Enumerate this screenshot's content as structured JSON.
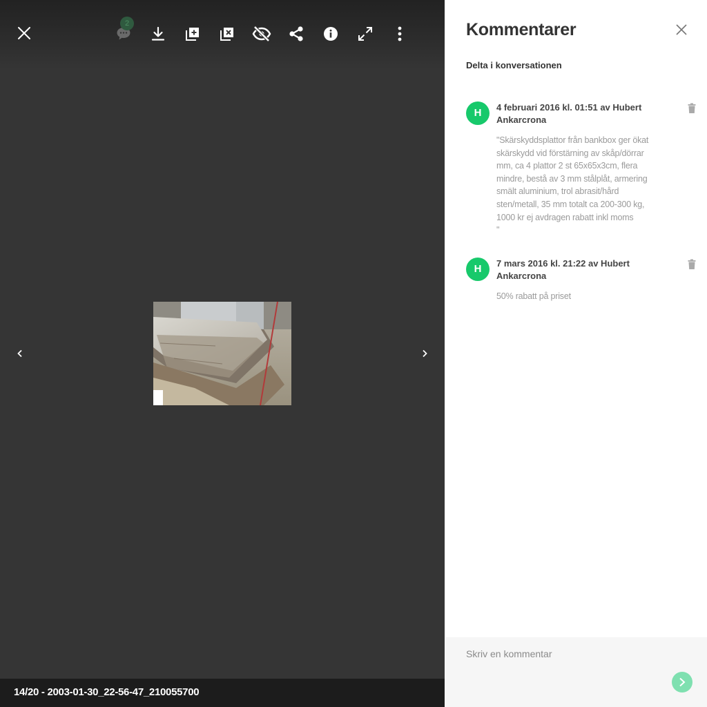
{
  "viewer": {
    "badge_count": "2",
    "caption": "14/20 - 2003-01-30_22-56-47_210055700",
    "icons": {
      "close": "close-icon",
      "comments": "comment-icon",
      "download": "download-icon",
      "add_to_album": "add-to-album-icon",
      "remove_from_album": "remove-from-album-icon",
      "hide": "eye-off-icon",
      "share": "share-icon",
      "info": "info-icon",
      "fullscreen": "fullscreen-icon",
      "more": "more-vertical-icon",
      "prev": "chevron-left-icon",
      "next": "chevron-right-icon"
    }
  },
  "comments_panel": {
    "title": "Kommentarer",
    "subtitle": "Delta i konversationen",
    "comments": [
      {
        "avatar_letter": "H",
        "meta": "4 februari 2016 kl. 01:51 av Hubert Ankarcrona",
        "body": "\"Skärskyddsplattor från bankbox ger ökat skärskydd vid förstärning av skåp/dörrar mm, ca 4 plattor 2 st 65x65x3cm, flera mindre, bestå av 3 mm stålplåt, armering smält aluminium, trol abrasit/hård sten/metall, 35 mm totalt ca 200-300 kg, 1000 kr ej avdragen rabatt inkl moms\n\""
      },
      {
        "avatar_letter": "H",
        "meta": "7 mars 2016 kl. 21:22 av Hubert Ankarcrona",
        "body": "50% rabatt på priset"
      }
    ],
    "composer_placeholder": "Skriv en kommentar"
  },
  "colors": {
    "avatar": "#17c96b",
    "send_button": "#7fe0b0",
    "viewer_bg": "#353535"
  }
}
